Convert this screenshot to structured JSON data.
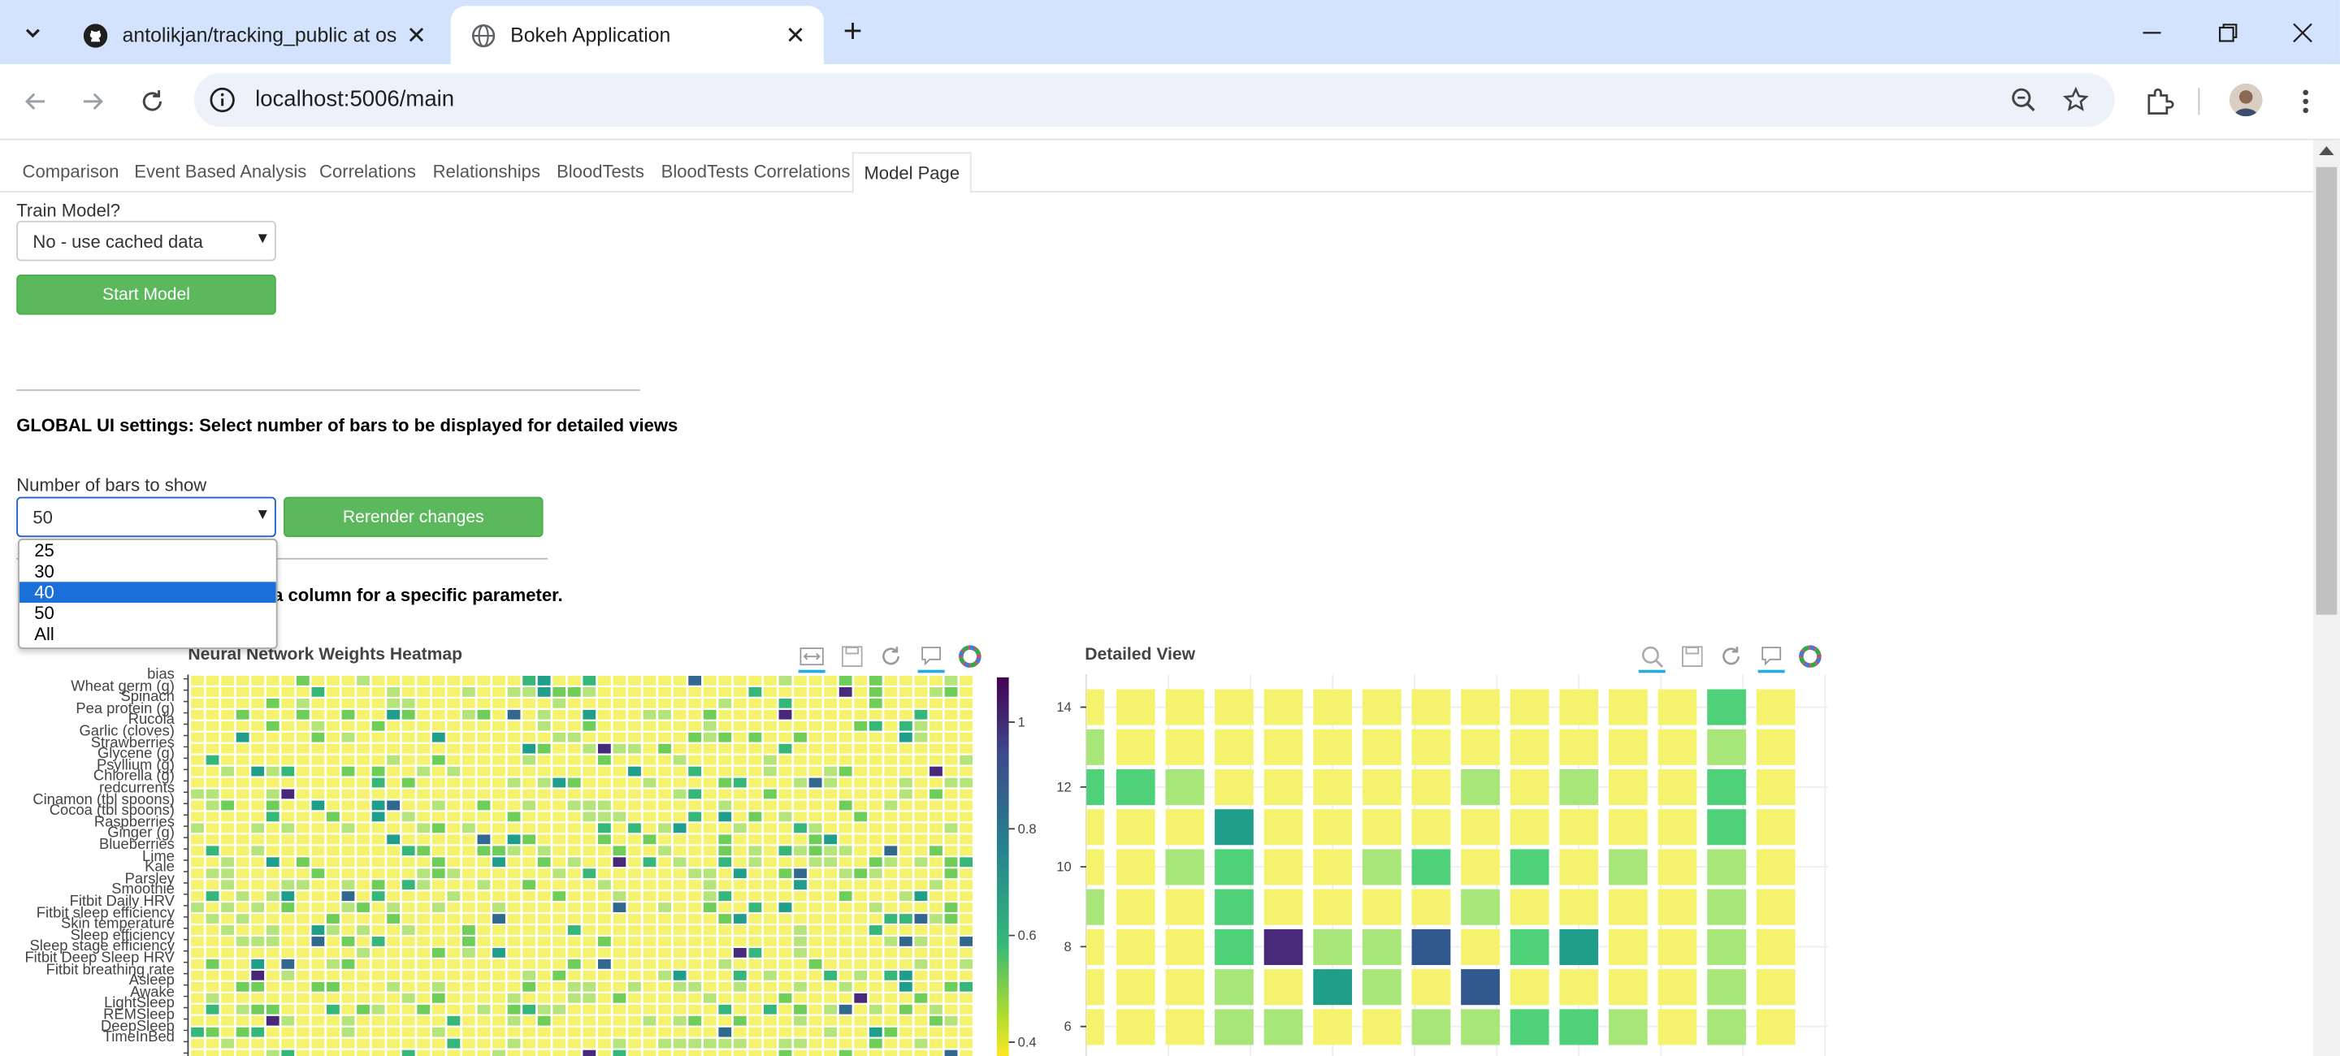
{
  "browser": {
    "tabs": [
      {
        "title": "antolikjan/tracking_public at os",
        "active": false
      },
      {
        "title": "Bokeh Application",
        "active": true
      }
    ],
    "url": "localhost:5006/main"
  },
  "colors": {
    "button_green": "#5cb85c",
    "select_highlight": "#1a6fd8",
    "heat_low": "#fde725",
    "heat_high": "#440154"
  },
  "page_tabs": [
    "Comparison",
    "Event Based Analysis",
    "Correlations",
    "Relationships",
    "BloodTests",
    "BloodTests Correlations",
    "Model Page"
  ],
  "train": {
    "label": "Train Model?",
    "value": "No - use cached data",
    "button": "Start Model"
  },
  "global": {
    "heading": "GLOBAL UI settings: Select number of bars to be displayed for detailed views",
    "bars_label": "Number of bars to show",
    "bars_value": "50",
    "rerender_button": "Rerender changes",
    "options": [
      "25",
      "30",
      "40",
      "50",
      "All"
    ],
    "highlighted_option": "40",
    "partial_instruction": "a column for a specific parameter."
  },
  "heatmap": {
    "title": "Neural Network Weights Heatmap",
    "rows": [
      "bias",
      "Wheat germ (g)",
      "Spinach",
      "Pea protein (g)",
      "Rucola",
      "Garlic (cloves)",
      "Strawberries",
      "Glycene (g)",
      "Psyllium (g)",
      "Chlorella (g)",
      "redcurrents",
      "Cinamon (tbl spoons)",
      "Cocoa (tbl spoons)",
      "Raspberries",
      "Ginger (g)",
      "Blueberries",
      "Lime",
      "Kale",
      "Parsley",
      "Smoothie",
      "Fitbit Daily HRV",
      "Fitbit sleep efficiency",
      "Skin temperature",
      "Sleep efficiency",
      "Sleep stage efficiency",
      "Fitbit Deep Sleep HRV",
      "Fitbit breathing rate",
      "Asleep",
      "Awake",
      "LightSleep",
      "REMSleep",
      "DeepSleep",
      "TimeInBed"
    ],
    "colorbar_ticks": [
      "1",
      "0.8",
      "0.6",
      "0.4"
    ]
  },
  "detail": {
    "title": "Detailed View",
    "y_ticks": [
      "14",
      "12",
      "10",
      "8",
      "6"
    ]
  }
}
